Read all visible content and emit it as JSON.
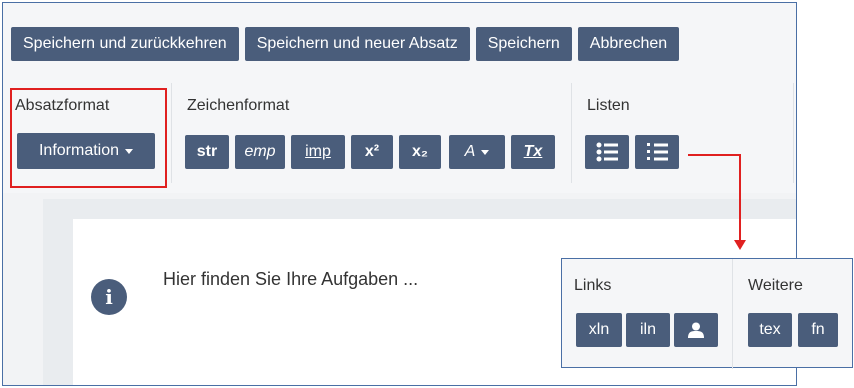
{
  "toolbar": {
    "actions": [
      "Speichern und zurückkehren",
      "Speichern und neuer Absatz",
      "Speichern",
      "Abbrechen"
    ]
  },
  "absatzformat": {
    "label": "Absatzformat",
    "button_label": "Information"
  },
  "zeichenformat": {
    "label": "Zeichenformat",
    "buttons": [
      "str",
      "emp",
      "imp",
      "x²",
      "x₂",
      "A",
      "Tx"
    ]
  },
  "listen": {
    "label": "Listen",
    "buttons": [
      "bullet-list-icon",
      "numbered-list-icon"
    ]
  },
  "content": {
    "text": "Hier finden Sie Ihre Aufgaben ..."
  },
  "popup": {
    "links_label": "Links",
    "links_buttons": [
      "xln",
      "iln"
    ],
    "weitere_label": "Weitere",
    "weitere_buttons": [
      "tex",
      "fn"
    ]
  },
  "colors": {
    "button_bg": "#4a5d7b",
    "highlight": "#e02020",
    "frame_border": "#4a6fa5"
  }
}
